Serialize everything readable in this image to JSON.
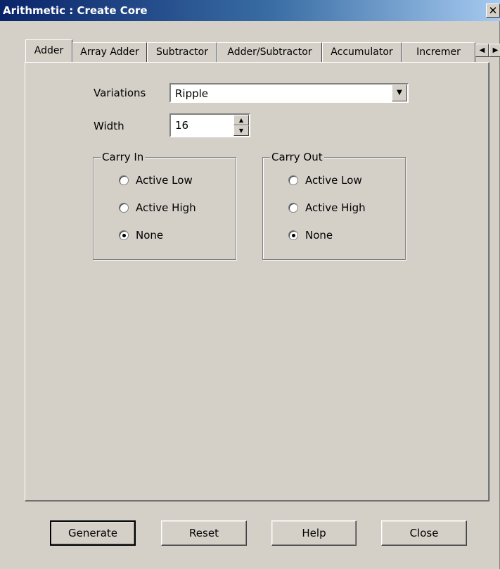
{
  "window": {
    "title": "Arithmetic : Create Core",
    "close_glyph": "✕"
  },
  "tabs": [
    "Adder",
    "Array Adder",
    "Subtractor",
    "Adder/Subtractor",
    "Accumulator",
    "Incremer"
  ],
  "tab_scroll": {
    "left_glyph": "◀",
    "right_glyph": "▶"
  },
  "form": {
    "variations_label": "Variations",
    "variations_value": "Ripple",
    "width_label": "Width",
    "width_value": "16"
  },
  "carry_in": {
    "title": "Carry In",
    "options": [
      "Active Low",
      "Active High",
      "None"
    ],
    "selected": "None"
  },
  "carry_out": {
    "title": "Carry Out",
    "options": [
      "Active Low",
      "Active High",
      "None"
    ],
    "selected": "None"
  },
  "buttons": {
    "generate": "Generate",
    "reset": "Reset",
    "help": "Help",
    "close": "Close"
  },
  "colors": {
    "dialog_bg": "#d4d0c8",
    "title_start": "#0a246a",
    "title_end": "#a6caf0"
  }
}
